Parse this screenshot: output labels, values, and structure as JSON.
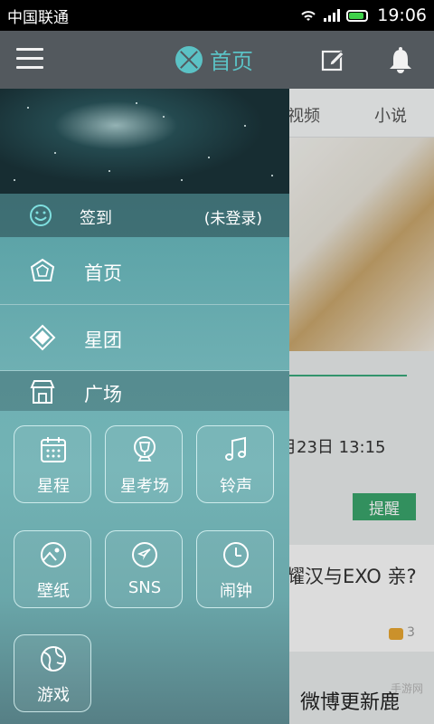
{
  "status_bar": {
    "carrier": "中国联通",
    "time": "19:06"
  },
  "app_bar": {
    "title": "首页"
  },
  "background": {
    "tabs": [
      "视频",
      "小说"
    ],
    "date_text": "月23日  13:15",
    "remind_button": "提醒",
    "card_title": "耀汉与EXO 亲?",
    "comment_count": "3",
    "bottom_text": "微博更新鹿",
    "watermark": "手游网"
  },
  "drawer": {
    "signin": {
      "label": "签到",
      "status": "(未登录)"
    },
    "nav": [
      {
        "label": "首页",
        "icon": "home-icon"
      },
      {
        "label": "星团",
        "icon": "diamond-icon"
      },
      {
        "label": "广场",
        "icon": "store-icon"
      }
    ],
    "tiles": [
      {
        "label": "星程",
        "icon": "calendar-icon"
      },
      {
        "label": "星考场",
        "icon": "trophy-icon"
      },
      {
        "label": "铃声",
        "icon": "music-icon"
      },
      {
        "label": "壁纸",
        "icon": "image-icon"
      },
      {
        "label": "SNS",
        "icon": "compass-icon"
      },
      {
        "label": "闹钟",
        "icon": "clock-icon"
      },
      {
        "label": "游戏",
        "icon": "planet-icon"
      }
    ]
  },
  "colors": {
    "accent": "#5bc2c5",
    "app_bar": "#53595e",
    "remind_green": "#3aa46b"
  }
}
